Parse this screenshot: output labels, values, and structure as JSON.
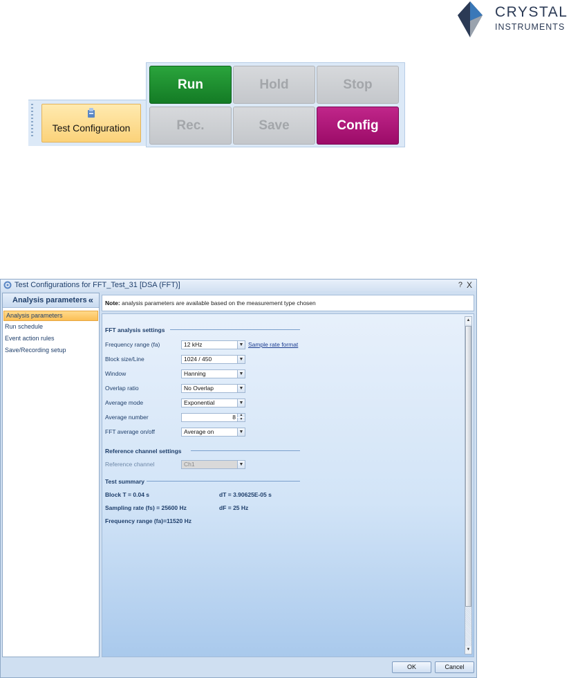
{
  "logo": {
    "line1": "CRYSTAL",
    "line2": "INSTRUMENTS",
    "colors": {
      "dark": "#2b3a55",
      "blue": "#3a78b8"
    }
  },
  "ribbon": {
    "test_configuration_label": "Test Configuration",
    "buttons": [
      {
        "label": "Run",
        "state": "enabled",
        "color": "#1c8f30"
      },
      {
        "label": "Hold",
        "state": "disabled"
      },
      {
        "label": "Stop",
        "state": "disabled"
      },
      {
        "label": "Rec.",
        "state": "disabled"
      },
      {
        "label": "Save",
        "state": "disabled"
      },
      {
        "label": "Config",
        "state": "enabled",
        "color": "#ad1578"
      }
    ]
  },
  "dialog": {
    "title": "Test Configurations for FFT_Test_31 [DSA (FFT)]",
    "help": "?",
    "close": "X",
    "nav": {
      "header": "Analysis parameters",
      "collapse_glyph": "«",
      "items": [
        "Analysis parameters",
        "Run schedule",
        "Event action rules",
        "Save/Recording setup"
      ]
    },
    "note": {
      "bold": "Note:",
      "text": " analysis parameters are available based on the measurement type chosen"
    },
    "fft_section": {
      "title": "FFT analysis settings",
      "fields": [
        {
          "label": "Frequency range (fa)",
          "value": "12 kHz"
        },
        {
          "label": "Block size/Line",
          "value": "1024 / 450"
        },
        {
          "label": "Window",
          "value": "Hanning"
        },
        {
          "label": "Overlap ratio",
          "value": "No Overlap"
        },
        {
          "label": "Average mode",
          "value": "Exponential"
        },
        {
          "label": "Average number",
          "value": "8"
        },
        {
          "label": "FFT average on/off",
          "value": "Average on"
        }
      ],
      "sample_rate_link": "Sample rate format"
    },
    "reference_section": {
      "title": "Reference channel settings",
      "label": "Reference channel",
      "value": "Ch1"
    },
    "summary_section": {
      "title": "Test summary",
      "block_t": "Block T = 0.04 s",
      "dt": "dT = 3.90625E-05 s",
      "sampling_rate": "Sampling rate (fs) = 25600 Hz",
      "df": "dF = 25 Hz",
      "freq_range": "Frequency range (fa)=11520 Hz"
    },
    "ok_label": "OK",
    "cancel_label": "Cancel"
  }
}
